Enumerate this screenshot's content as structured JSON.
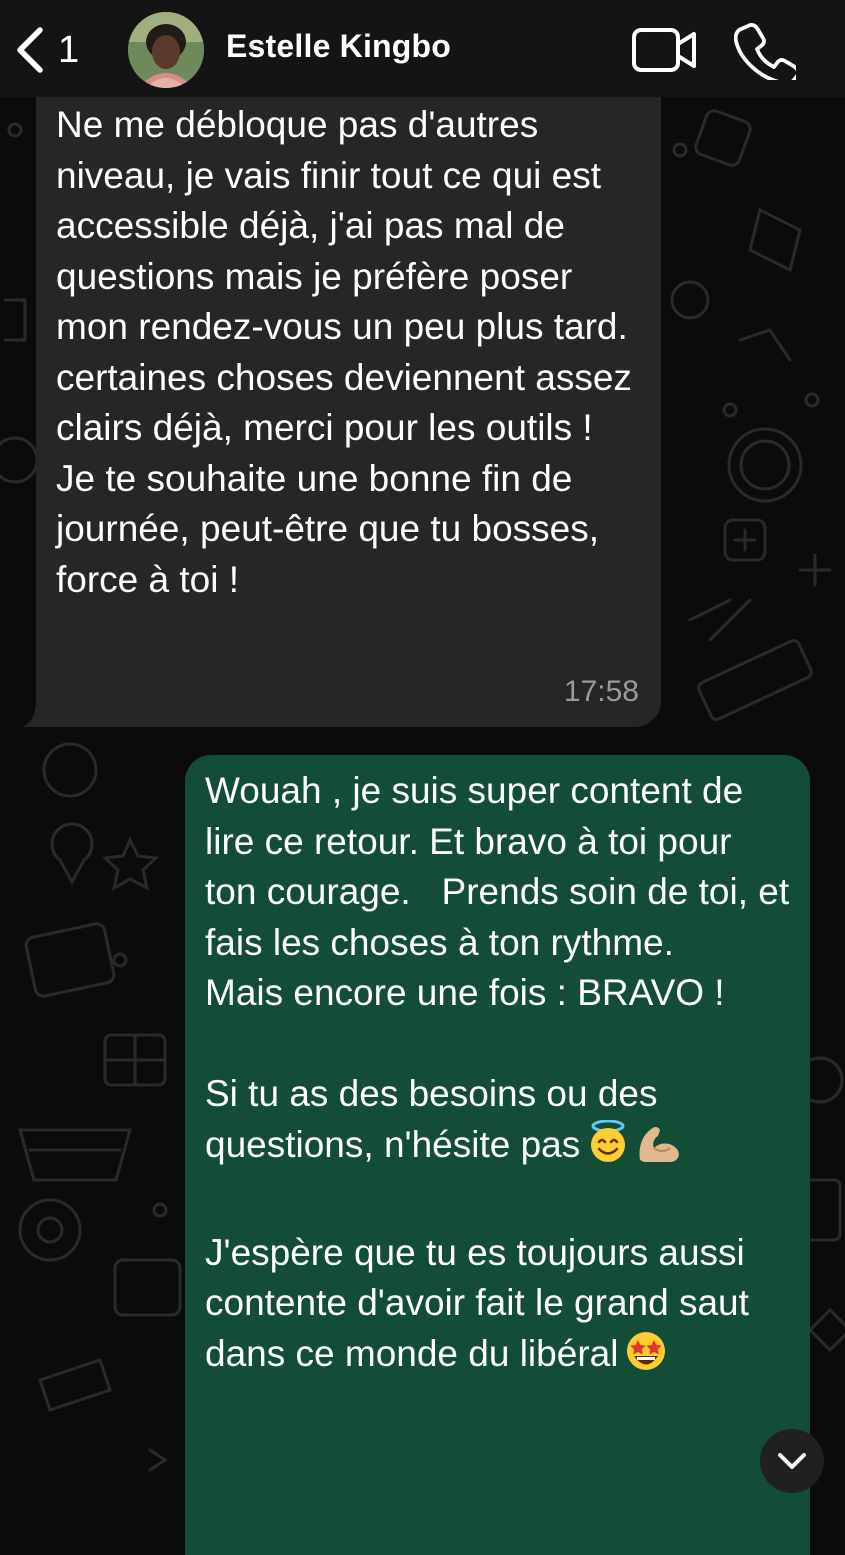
{
  "header": {
    "back_count": "1",
    "contact_name": "Estelle Kingbo"
  },
  "incoming_message": {
    "paragraphs": [
      "Ne me débloque pas d'autres niveau, je vais finir tout ce qui est accessible déjà, j'ai pas mal de questions mais je préfère poser mon rendez-vous un peu plus tard.",
      "certaines choses deviennent assez clairs déjà, merci pour les outils !",
      "Je te souhaite une bonne fin de journée, peut-être que tu bosses, force à toi !"
    ],
    "time": "17:58"
  },
  "outgoing_message": {
    "p1": "Wouah , je suis super content de lire ce retour. Et bravo à toi pour ton courage.   Prends soin de toi, et fais les choses à ton rythme.",
    "p2": "Mais encore une fois : BRAVO !",
    "p3": "Si tu as des besoins ou des questions, n'hésite pas",
    "p3_emojis": [
      "smiling-face-with-halo",
      "flexed-biceps"
    ],
    "p4": "J'espère que tu es toujours aussi contente d'avoir fait le grand saut dans ce monde du libéral",
    "p4_emoji": "star-struck"
  },
  "colors": {
    "background": "#0b0b0b",
    "header": "#141414",
    "incoming_bubble": "#252626",
    "outgoing_bubble": "#144d37",
    "timestamp": "#9a9a9a"
  },
  "icons": {
    "back": "chevron-left-icon",
    "video": "video-camera-icon",
    "call": "phone-icon",
    "scroll": "chevron-down-icon"
  }
}
